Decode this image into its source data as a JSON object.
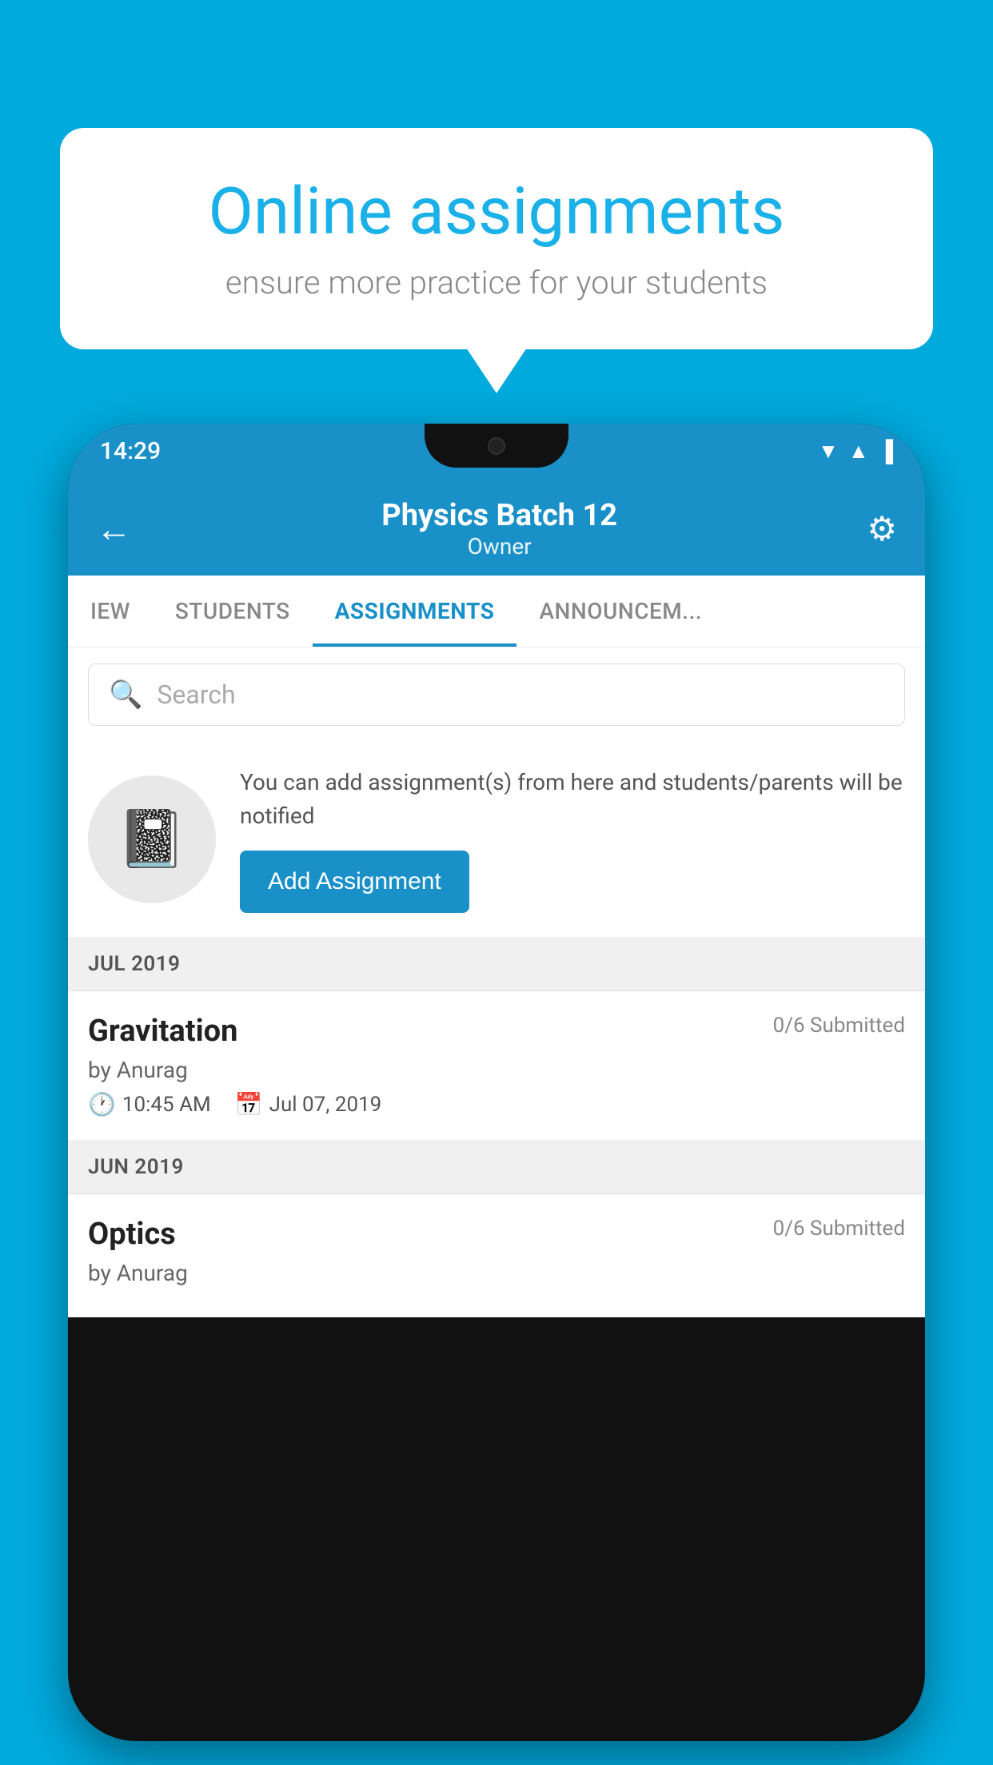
{
  "background_color": "#00AADD",
  "bubble": {
    "title": "Online assignments",
    "subtitle": "ensure more practice for your students"
  },
  "phone": {
    "status_bar": {
      "time": "14:29",
      "icons": [
        "▲",
        "▲",
        "▐"
      ]
    },
    "header": {
      "title": "Physics Batch 12",
      "subtitle": "Owner",
      "back_icon": "←",
      "gear_icon": "⚙"
    },
    "tabs": [
      {
        "label": "IEW",
        "active": false
      },
      {
        "label": "STUDENTS",
        "active": false
      },
      {
        "label": "ASSIGNMENTS",
        "active": true
      },
      {
        "label": "ANNOUNCEMENTS",
        "active": false
      }
    ],
    "search": {
      "placeholder": "Search"
    },
    "promo": {
      "description": "You can add assignment(s) from here and students/parents will be notified",
      "button_label": "Add Assignment"
    },
    "sections": [
      {
        "header": "JUL 2019",
        "assignments": [
          {
            "name": "Gravitation",
            "submitted": "0/6 Submitted",
            "by": "by Anurag",
            "time": "10:45 AM",
            "date": "Jul 07, 2019"
          }
        ]
      },
      {
        "header": "JUN 2019",
        "assignments": [
          {
            "name": "Optics",
            "submitted": "0/6 Submitted",
            "by": "by Anurag",
            "time": "",
            "date": ""
          }
        ]
      }
    ]
  }
}
